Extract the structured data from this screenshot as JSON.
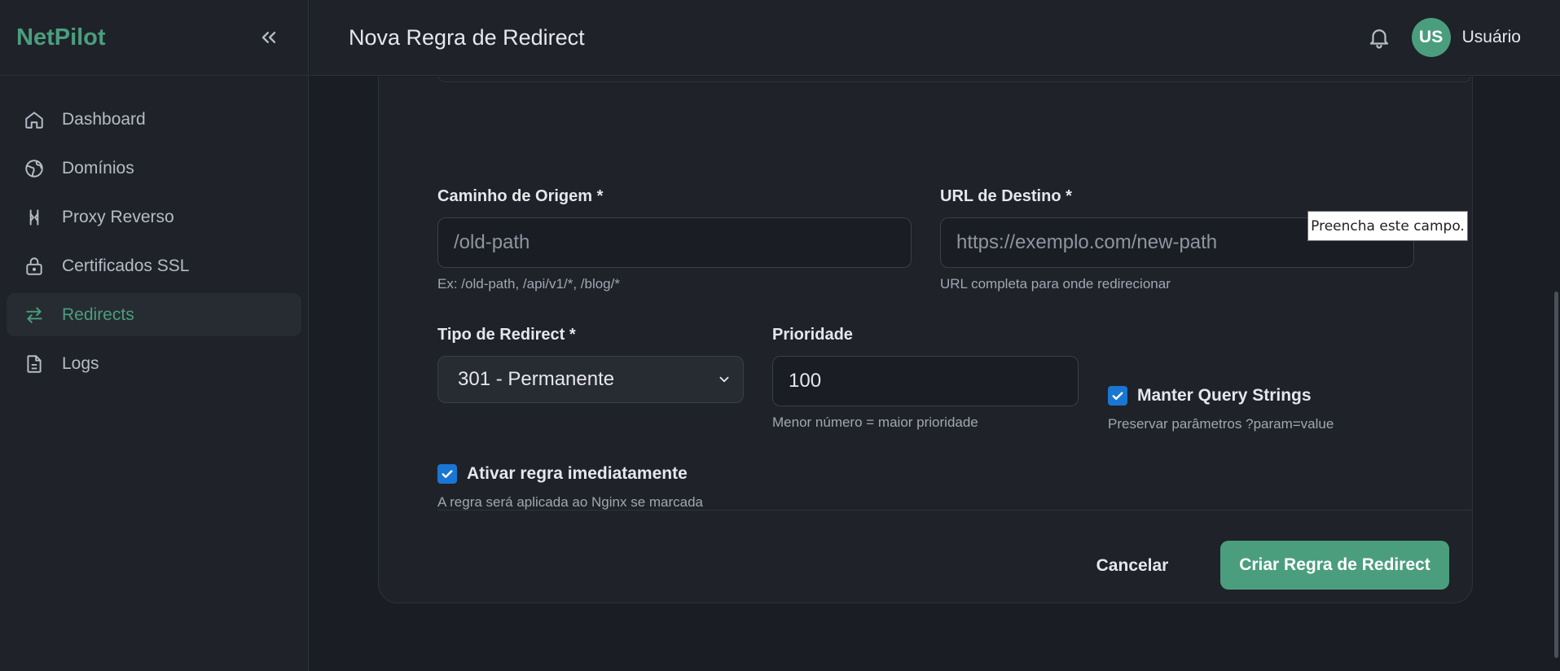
{
  "app": {
    "brand": "NetPilot"
  },
  "sidebar": {
    "items": [
      {
        "label": "Dashboard",
        "icon": "home-icon"
      },
      {
        "label": "Domínios",
        "icon": "globe-icon"
      },
      {
        "label": "Proxy Reverso",
        "icon": "proxy-icon"
      },
      {
        "label": "Certificados SSL",
        "icon": "lock-icon"
      },
      {
        "label": "Redirects",
        "icon": "arrows-icon",
        "active": true
      },
      {
        "label": "Logs",
        "icon": "file-icon"
      }
    ]
  },
  "header": {
    "title": "Nova Regra de Redirect",
    "user": {
      "initials": "US",
      "name": "Usuário"
    }
  },
  "form": {
    "source": {
      "label": "Caminho de Origem *",
      "placeholder": "/old-path",
      "hint": "Ex: /old-path, /api/v1/*, /blog/*"
    },
    "destination": {
      "label": "URL de Destino *",
      "placeholder": "https://exemplo.com/new-path",
      "hint": "URL completa para onde redirecionar"
    },
    "type": {
      "label": "Tipo de Redirect *",
      "value": "301 - Permanente"
    },
    "priority": {
      "label": "Prioridade",
      "value": "100",
      "hint": "Menor número = maior prioridade"
    },
    "query_strings": {
      "label": "Manter Query Strings",
      "hint": "Preservar parâmetros ?param=value",
      "checked": true
    },
    "activate": {
      "label": "Ativar regra imediatamente",
      "hint": "A regra será aplicada ao Nginx se marcada",
      "checked": true
    },
    "cancel_label": "Cancelar",
    "submit_label": "Criar Regra de Redirect"
  },
  "tooltip": {
    "text": "Preencha este campo."
  },
  "colors": {
    "accent": "#4a9e7e",
    "checkbox": "#1976d2",
    "background": "#1a1d23",
    "panel": "#1f2228"
  }
}
